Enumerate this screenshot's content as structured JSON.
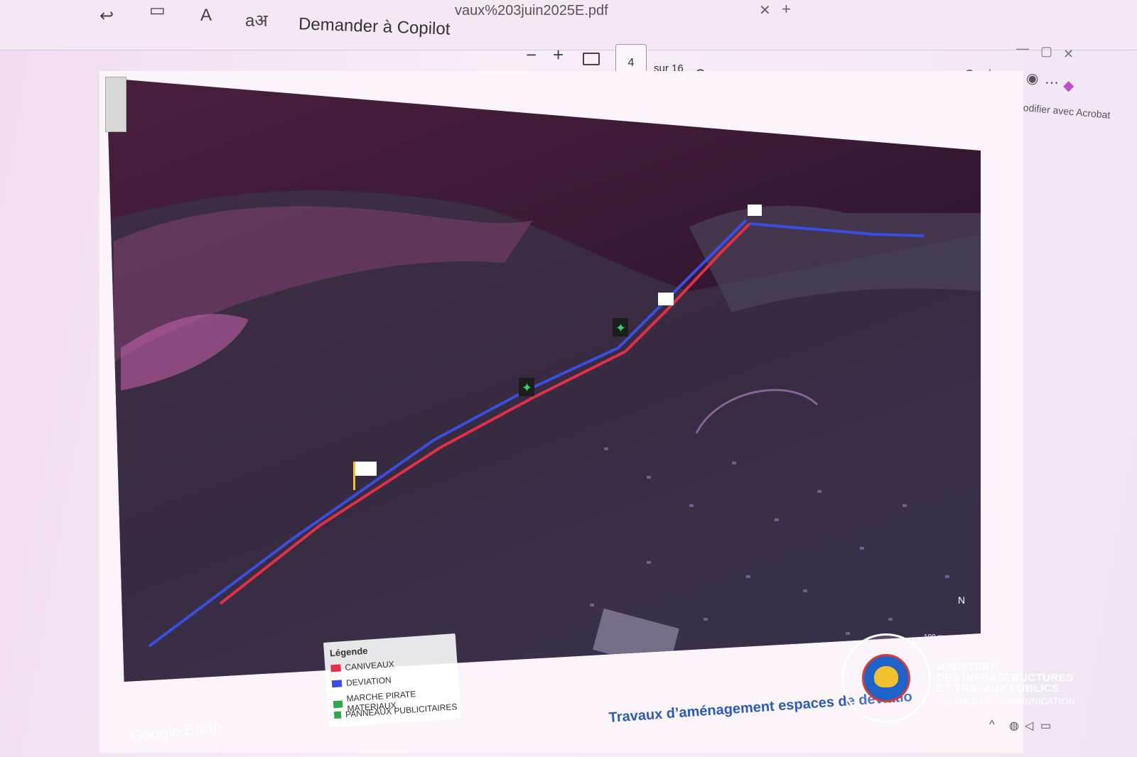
{
  "browser": {
    "tab_title": "vaux%203juin2025E.pdf",
    "tab_close": "✕",
    "tab_new": "+",
    "copilot_label": "Demander à Copilot",
    "read_aloud_icon": "A",
    "translate_icon": "aअ"
  },
  "pdf_toolbar": {
    "zoom_out": "−",
    "zoom_in": "+",
    "current_page": "4",
    "total_pages": "sur 16",
    "edit_with_acrobat": "Modifier avec Acrobat"
  },
  "map": {
    "legend_title": "Légende",
    "legend_items": [
      {
        "label": "CANIVEAUX",
        "color": "#e0304a"
      },
      {
        "label": "DEVIATION",
        "color": "#3a4fe0"
      },
      {
        "label": "MARCHE PIRATE MATERIAUX",
        "color": "#2fa74a"
      },
      {
        "label": "PANNEAUX PUBLICITAIRES",
        "color": "#2fa74a"
      }
    ],
    "scale_label": "100 m",
    "watermark": "Google Earth"
  },
  "page_caption": "Travaux d’aménagement espaces de déviatio",
  "ministry": {
    "line1": "MINISTERE",
    "line2": "DES INFRASTRUCTURES",
    "line3": "ET TRAVAUX PUBLICS",
    "subtitle": "CELLULE DE COMMUNICATION",
    "seal_text": "PAIX"
  },
  "colors": {
    "route_red": "#e0304a",
    "route_blue": "#3a4fe0",
    "accent": "#2b5bb8"
  }
}
